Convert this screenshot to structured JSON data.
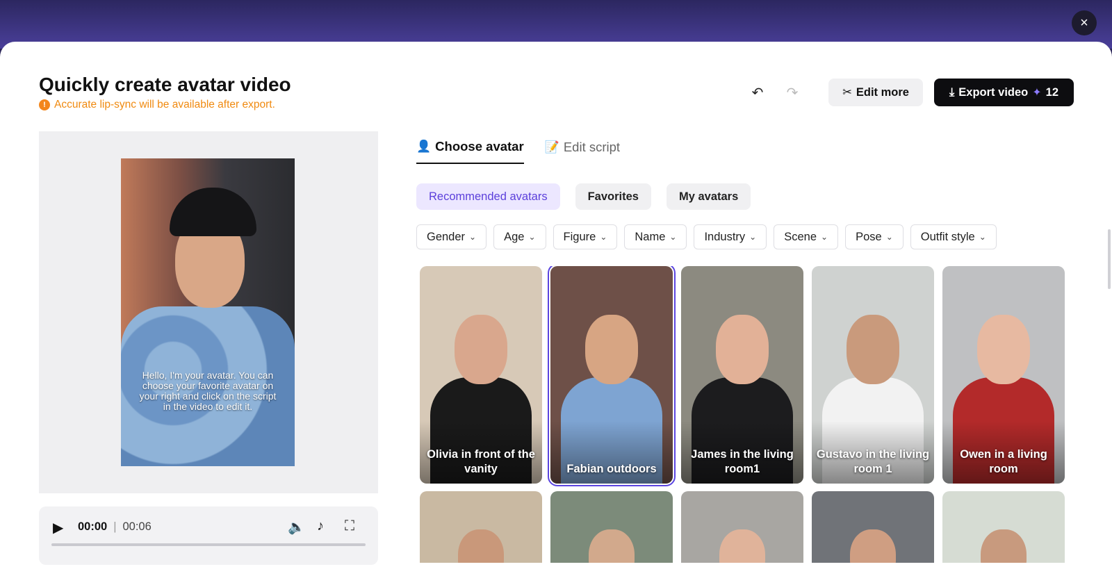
{
  "modal": {
    "title": "Quickly create avatar video",
    "warning": "Accurate lip-sync will be available after export.",
    "close_icon": "×"
  },
  "actions": {
    "undo_icon": "↶",
    "redo_icon": "↷",
    "edit_more_label": "Edit more",
    "export_label": "Export video",
    "export_credits": "12"
  },
  "preview": {
    "caption": "Hello, I'm your avatar. You can choose your favorite avatar on your right and click on the script in the video to edit it.",
    "current_time": "00:00",
    "separator": "|",
    "duration": "00:06",
    "progress": 0
  },
  "tabs": [
    {
      "label": "Choose avatar",
      "active": true
    },
    {
      "label": "Edit script",
      "active": false
    }
  ],
  "chips": [
    {
      "label": "Recommended avatars",
      "active": true
    },
    {
      "label": "Favorites",
      "active": false
    },
    {
      "label": "My avatars",
      "active": false
    }
  ],
  "filters": [
    "Gender",
    "Age",
    "Figure",
    "Name",
    "Industry",
    "Scene",
    "Pose",
    "Outfit style"
  ],
  "avatars": [
    {
      "label": "Olivia in front of the vanity",
      "bg": "#d7c9b7",
      "skin": "#d9a78d",
      "cloth": "#1a1a1a",
      "selected": false
    },
    {
      "label": "Fabian outdoors",
      "bg": "#6e5048",
      "skin": "#d7a583",
      "cloth": "#7ea4d2",
      "selected": true
    },
    {
      "label": "James in the living room1",
      "bg": "#8c8a80",
      "skin": "#e2b197",
      "cloth": "#1c1c1e",
      "selected": false
    },
    {
      "label": "Gustavo in the living room 1",
      "bg": "#cfd2d0",
      "skin": "#c99a7c",
      "cloth": "#f2f2f2",
      "selected": false
    },
    {
      "label": "Owen in a living room",
      "bg": "#bfc0c2",
      "skin": "#e7b9a1",
      "cloth": "#b32a2a",
      "selected": false
    }
  ],
  "avatars_row2": [
    {
      "bg": "#c9b9a2",
      "skin": "#c9987a"
    },
    {
      "bg": "#7c8b7a",
      "skin": "#d2a98c"
    },
    {
      "bg": "#a8a6a2",
      "skin": "#e0b39a"
    },
    {
      "bg": "#707378",
      "skin": "#cf9e82"
    },
    {
      "bg": "#d6dcd3",
      "skin": "#c89a7e"
    }
  ]
}
